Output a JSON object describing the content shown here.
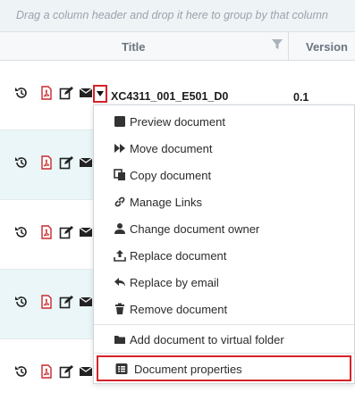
{
  "group_bar": {
    "hint": "Drag a column header and drop it here to group by that column"
  },
  "columns": {
    "title": "Title",
    "version": "Version"
  },
  "selected_row": {
    "title": "XC4311_001_E501_D0",
    "version": "0.1"
  },
  "row_icons": [
    "history-icon",
    "pdf-icon",
    "edit-icon",
    "envelope-icon",
    "caret-down-icon"
  ],
  "menu": {
    "items": [
      {
        "label": "Preview document",
        "icon": "square-icon"
      },
      {
        "label": "Move document",
        "icon": "fast-forward-icon"
      },
      {
        "label": "Copy document",
        "icon": "copy-icon"
      },
      {
        "label": "Manage Links",
        "icon": "link-icon"
      },
      {
        "label": "Change document owner",
        "icon": "user-icon"
      },
      {
        "label": "Replace document",
        "icon": "upload-icon"
      },
      {
        "label": "Replace by email",
        "icon": "reply-icon"
      },
      {
        "label": "Remove document",
        "icon": "trash-icon"
      },
      {
        "label": "Add document to virtual folder",
        "icon": "folder-icon"
      },
      {
        "label": "Document properties",
        "icon": "list-icon"
      }
    ]
  },
  "colors": {
    "highlight_red": "#d4242a",
    "pdf_red": "#c8282b",
    "row_alt": "#eaf6f7"
  }
}
